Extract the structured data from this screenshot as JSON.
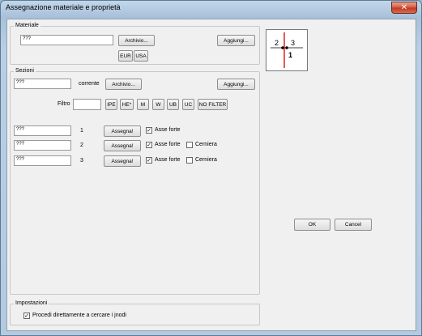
{
  "window": {
    "title": "Assegnazione materiale e proprietà",
    "close_glyph": "✕"
  },
  "materiale": {
    "group_label": "Materiale",
    "input_value": "???",
    "archivio_label": "Archivio...",
    "aggiungi_label": "Aggiungi...",
    "eur_label": "EUR",
    "usa_label": "USA"
  },
  "sezioni": {
    "group_label": "Sezioni",
    "input_value": "???",
    "corrente_label": "corrente",
    "archivio_label": "Archivio...",
    "aggiungi_label": "Aggiungi...",
    "filtro_label": "Filtro",
    "filtro_value": "",
    "filters": [
      "IPE",
      "HE*",
      "M",
      "W",
      "UB",
      "UC",
      "NO FILTER"
    ],
    "rows": [
      {
        "value": "???",
        "number": "1",
        "assign_label": "Assegna!",
        "asse_forte_label": "Asse forte",
        "asse_forte_checked": true,
        "has_cerniera": false
      },
      {
        "value": "???",
        "number": "2",
        "assign_label": "Assegna!",
        "asse_forte_label": "Asse forte",
        "asse_forte_checked": true,
        "has_cerniera": true,
        "cerniera_label": "Cerniera",
        "cerniera_checked": false
      },
      {
        "value": "???",
        "number": "3",
        "assign_label": "Assegna!",
        "asse_forte_label": "Asse forte",
        "asse_forte_checked": true,
        "has_cerniera": true,
        "cerniera_label": "Cerniera",
        "cerniera_checked": false
      }
    ]
  },
  "preview": {
    "label_left": "2",
    "label_right": "3",
    "label_bottom": "1",
    "axis_color": "#e02020"
  },
  "actions": {
    "ok_label": "OK",
    "cancel_label": "Cancel"
  },
  "impostazioni": {
    "group_label": "Impostazioni",
    "checkbox_label": "Procedi direttamente a cercare i jnodi",
    "checked": true
  }
}
